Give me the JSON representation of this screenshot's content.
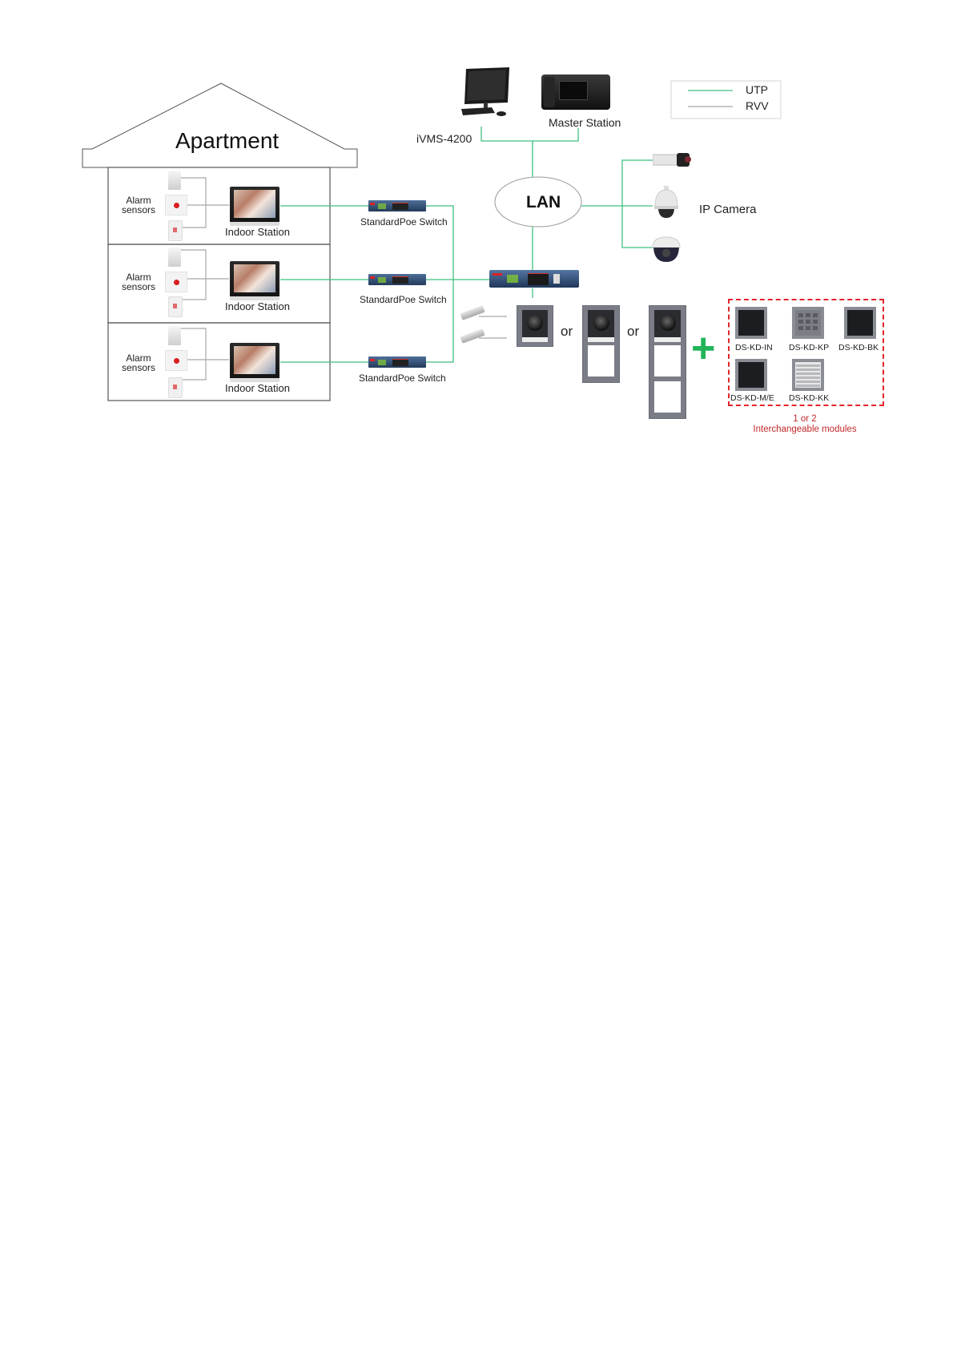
{
  "legend": {
    "items": [
      {
        "label": "UTP",
        "color": "#3fbf7f"
      },
      {
        "label": "RVV",
        "color": "#a8a8a8"
      }
    ]
  },
  "building": {
    "title": "Apartment",
    "floors": [
      {
        "sensors_label": "Alarm sensors",
        "station_label": "Indoor Station",
        "switch_label": "StandardPoe Switch"
      },
      {
        "sensors_label": "Alarm sensors",
        "station_label": "Indoor Station",
        "switch_label": "StandardPoe Switch"
      },
      {
        "sensors_label": "Alarm sensors",
        "station_label": "Indoor Station",
        "switch_label": "StandardPoe Switch"
      }
    ],
    "sensors_line1": "Alarm",
    "sensors_line2": "sensors"
  },
  "top": {
    "client_label": "iVMS-4200",
    "master_label": "Master Station"
  },
  "network": {
    "lan_label": "LAN",
    "camera_label": "IP Camera"
  },
  "door_stations": {
    "separator": "or"
  },
  "modules": {
    "items": [
      "DS-KD-IN",
      "DS-KD-KP",
      "DS-KD-BK",
      "DS-KD-M/E",
      "DS-KD-KK"
    ],
    "note_line1": "1 or 2",
    "note_line2": "Interchangeable modules",
    "note_color": "#c0292b",
    "border_color": "#e0262b"
  },
  "colors": {
    "utp": "#3fbf7f",
    "rvv": "#a8a8a8",
    "plus": "#22b459"
  }
}
